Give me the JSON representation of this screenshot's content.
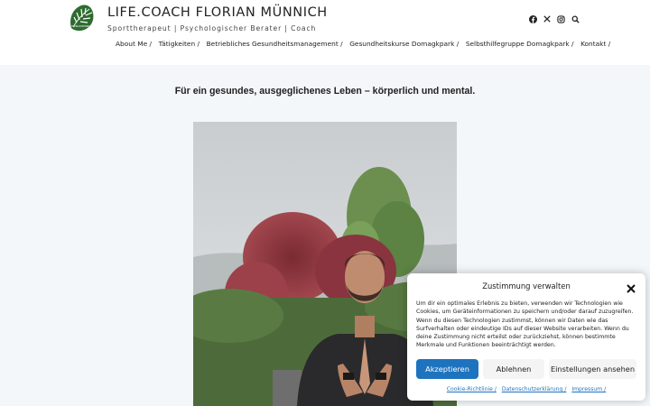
{
  "header": {
    "logo_text": "FLORIAN MÜNNICH",
    "site_title": "LIFE.COACH FLORIAN MÜNNICH",
    "tagline": "Sporttherapeut | Psychologischer Berater | Coach"
  },
  "social": [
    {
      "icon": "facebook-icon"
    },
    {
      "icon": "x-icon"
    },
    {
      "icon": "instagram-icon"
    },
    {
      "icon": "search-icon"
    }
  ],
  "nav": [
    {
      "label": "About Me /",
      "name": "about-me"
    },
    {
      "label": "Tätigkeiten /",
      "name": "taetigkeiten"
    },
    {
      "label": "Betriebliches Gesundheitsmanagement /",
      "name": "betriebliches-gesundheitsmanagement"
    },
    {
      "label": "Gesundheitskurse Domagkpark /",
      "name": "gesundheitskurse-domagkpark"
    },
    {
      "label": "Selbsthilfegruppe Domagkpark /",
      "name": "selbsthilfegruppe-domagkpark"
    },
    {
      "label": "Kontakt /",
      "name": "kontakt"
    }
  ],
  "main": {
    "slogan": "Für ein gesundes, ausgeglichenes Leben – körperlich und mental."
  },
  "cookie": {
    "title": "Zustimmung verwalten",
    "text": "Um dir ein optimales Erlebnis zu bieten, verwenden wir Technologien wie Cookies, um Geräteinformationen zu speichern und/oder darauf zuzugreifen. Wenn du diesen Technologien zustimmst, können wir Daten wie das Surfverhalten oder eindeutige IDs auf dieser Website verarbeiten. Wenn du deine Zustimmung nicht erteilst oder zurückziehst, können bestimmte Merkmale und Funktionen beeinträchtigt werden.",
    "accept_label": "Akzeptieren",
    "deny_label": "Ablehnen",
    "settings_label": "Einstellungen ansehen",
    "links": [
      "Cookie-Richtlinie /",
      "Datenschutzerklärung /",
      "Impressum /"
    ]
  },
  "colors": {
    "accent": "#1e73be",
    "page_background": "#f3f7fa",
    "header_background": "#ffffff"
  }
}
